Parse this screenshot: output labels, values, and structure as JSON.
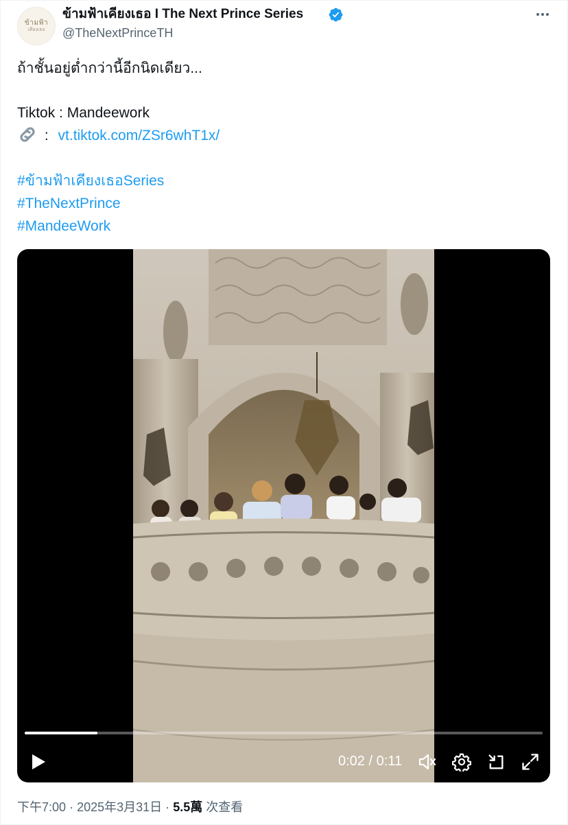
{
  "author": {
    "display_name": "ข้ามฟ้าเคียงเธอ I The Next Prince Series",
    "handle": "@TheNextPrinceTH",
    "avatar_text_line1": "ข้ามฟ้า",
    "avatar_text_line2": "เคียงเธอ",
    "verified_color": "#1d9bf0"
  },
  "tweet": {
    "line1": "ถ้าชั้นอยู่ต่ำกว่านี้อีกนิดเดียว...",
    "tiktok_label": "Tiktok : Mandeework",
    "link_separator": ":",
    "link_url_text": "vt.tiktok.com/ZSr6whT1x/",
    "hashtags": [
      "#ข้ามฟ้าเคียงเธอSeries",
      "#TheNextPrince",
      "#MandeeWork"
    ]
  },
  "video": {
    "current_time": "0:02",
    "separator": "/",
    "duration": "0:11",
    "progress_fraction": 0.14
  },
  "footer": {
    "time": "下午7:00",
    "date": "2025年3月31日",
    "views_count": "5.5萬",
    "views_label": "次查看",
    "dot": "·"
  },
  "colors": {
    "link": "#1d9bf0",
    "secondary_text": "#536471",
    "primary_text": "#0f1419"
  }
}
